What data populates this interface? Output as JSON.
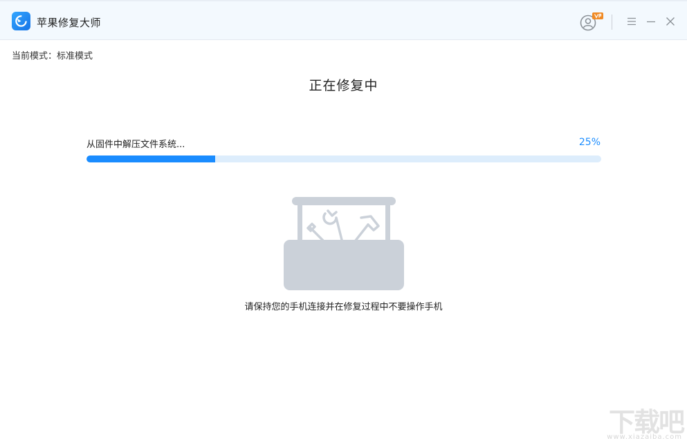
{
  "window": {
    "app_title": "苹果修复大师",
    "icons": {
      "logo": "app-logo-icon",
      "user": "user-account-icon",
      "vip": "vip-badge-icon",
      "menu": "menu-icon",
      "minimize": "minimize-icon",
      "close": "close-icon"
    }
  },
  "mode": {
    "label": "当前模式：标准模式"
  },
  "status": {
    "title": "正在修复中"
  },
  "progress": {
    "step": "从固件中解压文件系统...",
    "percent_label": "25%",
    "percent": 25
  },
  "hint": "请保持您的手机连接并在修复过程中不要操作手机",
  "watermark": {
    "text": "下载吧",
    "url": "www.xiazaiba.com"
  },
  "colors": {
    "accent": "#1a8cff",
    "track": "#ddedfc",
    "titlebar_bg": "#f3f9fe",
    "illustration": "#cbd1d9",
    "badge": "#f08a24"
  }
}
